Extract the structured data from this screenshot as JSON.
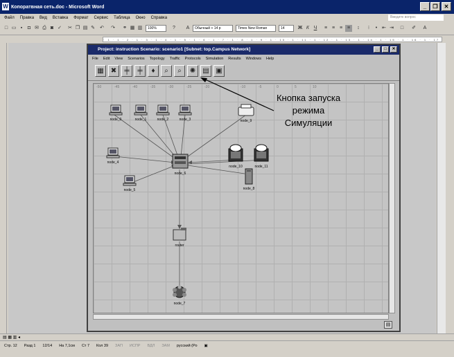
{
  "word": {
    "title": "Копоратвная сеть.doc - Microsoft Word",
    "menu": [
      "Файл",
      "Правка",
      "Вид",
      "Вставка",
      "Формат",
      "Сервис",
      "Таблица",
      "Окно",
      "Справка"
    ],
    "help_placeholder": "Введите вопрос",
    "zoom": "100%",
    "style": "Обычный + 14 р",
    "font": "Times New Roman",
    "font_size": "14",
    "ruler": "· 1 · 1 · 2 · 1 · 3 · 1 · 4 · 1 · 5 · 1 · 6 · 1 · 7 · 1 · 8 · 1 · 9 · 1 · 10 · 1 · 11 · 1 · 12 · 1 · 13 · 1 · 14 · 1 · 15 · 1 · 16 · 1 · 17",
    "status": {
      "page": "Стр. 12",
      "section": "Разд 1",
      "pages": "12/14",
      "at": "На 7,1см",
      "line": "Ст 7",
      "col": "Кол 39",
      "rec": "ЗАП",
      "trk": "ИСПР",
      "ext": "ВДЛ",
      "ovr": "ЗАМ",
      "lang": "русский (Ро"
    }
  },
  "opnet": {
    "title": "Project: instruction Scenario: scenario1 [Subnet: top.Campus Network]",
    "menu": [
      "File",
      "Edit",
      "View",
      "Scenarios",
      "Topology",
      "Traffic",
      "Protocols",
      "Simulation",
      "Results",
      "Windows",
      "Help"
    ],
    "ticks_top": [
      "-50",
      "-45",
      "-40",
      "-35",
      "-30",
      "-25",
      "-20",
      "-15",
      "-10",
      "-5",
      "0",
      "5",
      "10"
    ],
    "nodes": {
      "node_0": "node_0",
      "node_1": "node_1",
      "node_2": "node_2",
      "node_3": "node_3",
      "node_4": "node_4",
      "node_5": "node_5",
      "node_6": "node_6",
      "node_7": "node_7",
      "node_8": "node_8",
      "node_9": "node_9",
      "node_10": "node_10",
      "node_11": "node_11",
      "router": "router"
    }
  },
  "callout": {
    "line1": "Кнопка запуска",
    "line2": "режима",
    "line3": "Симуляции"
  }
}
